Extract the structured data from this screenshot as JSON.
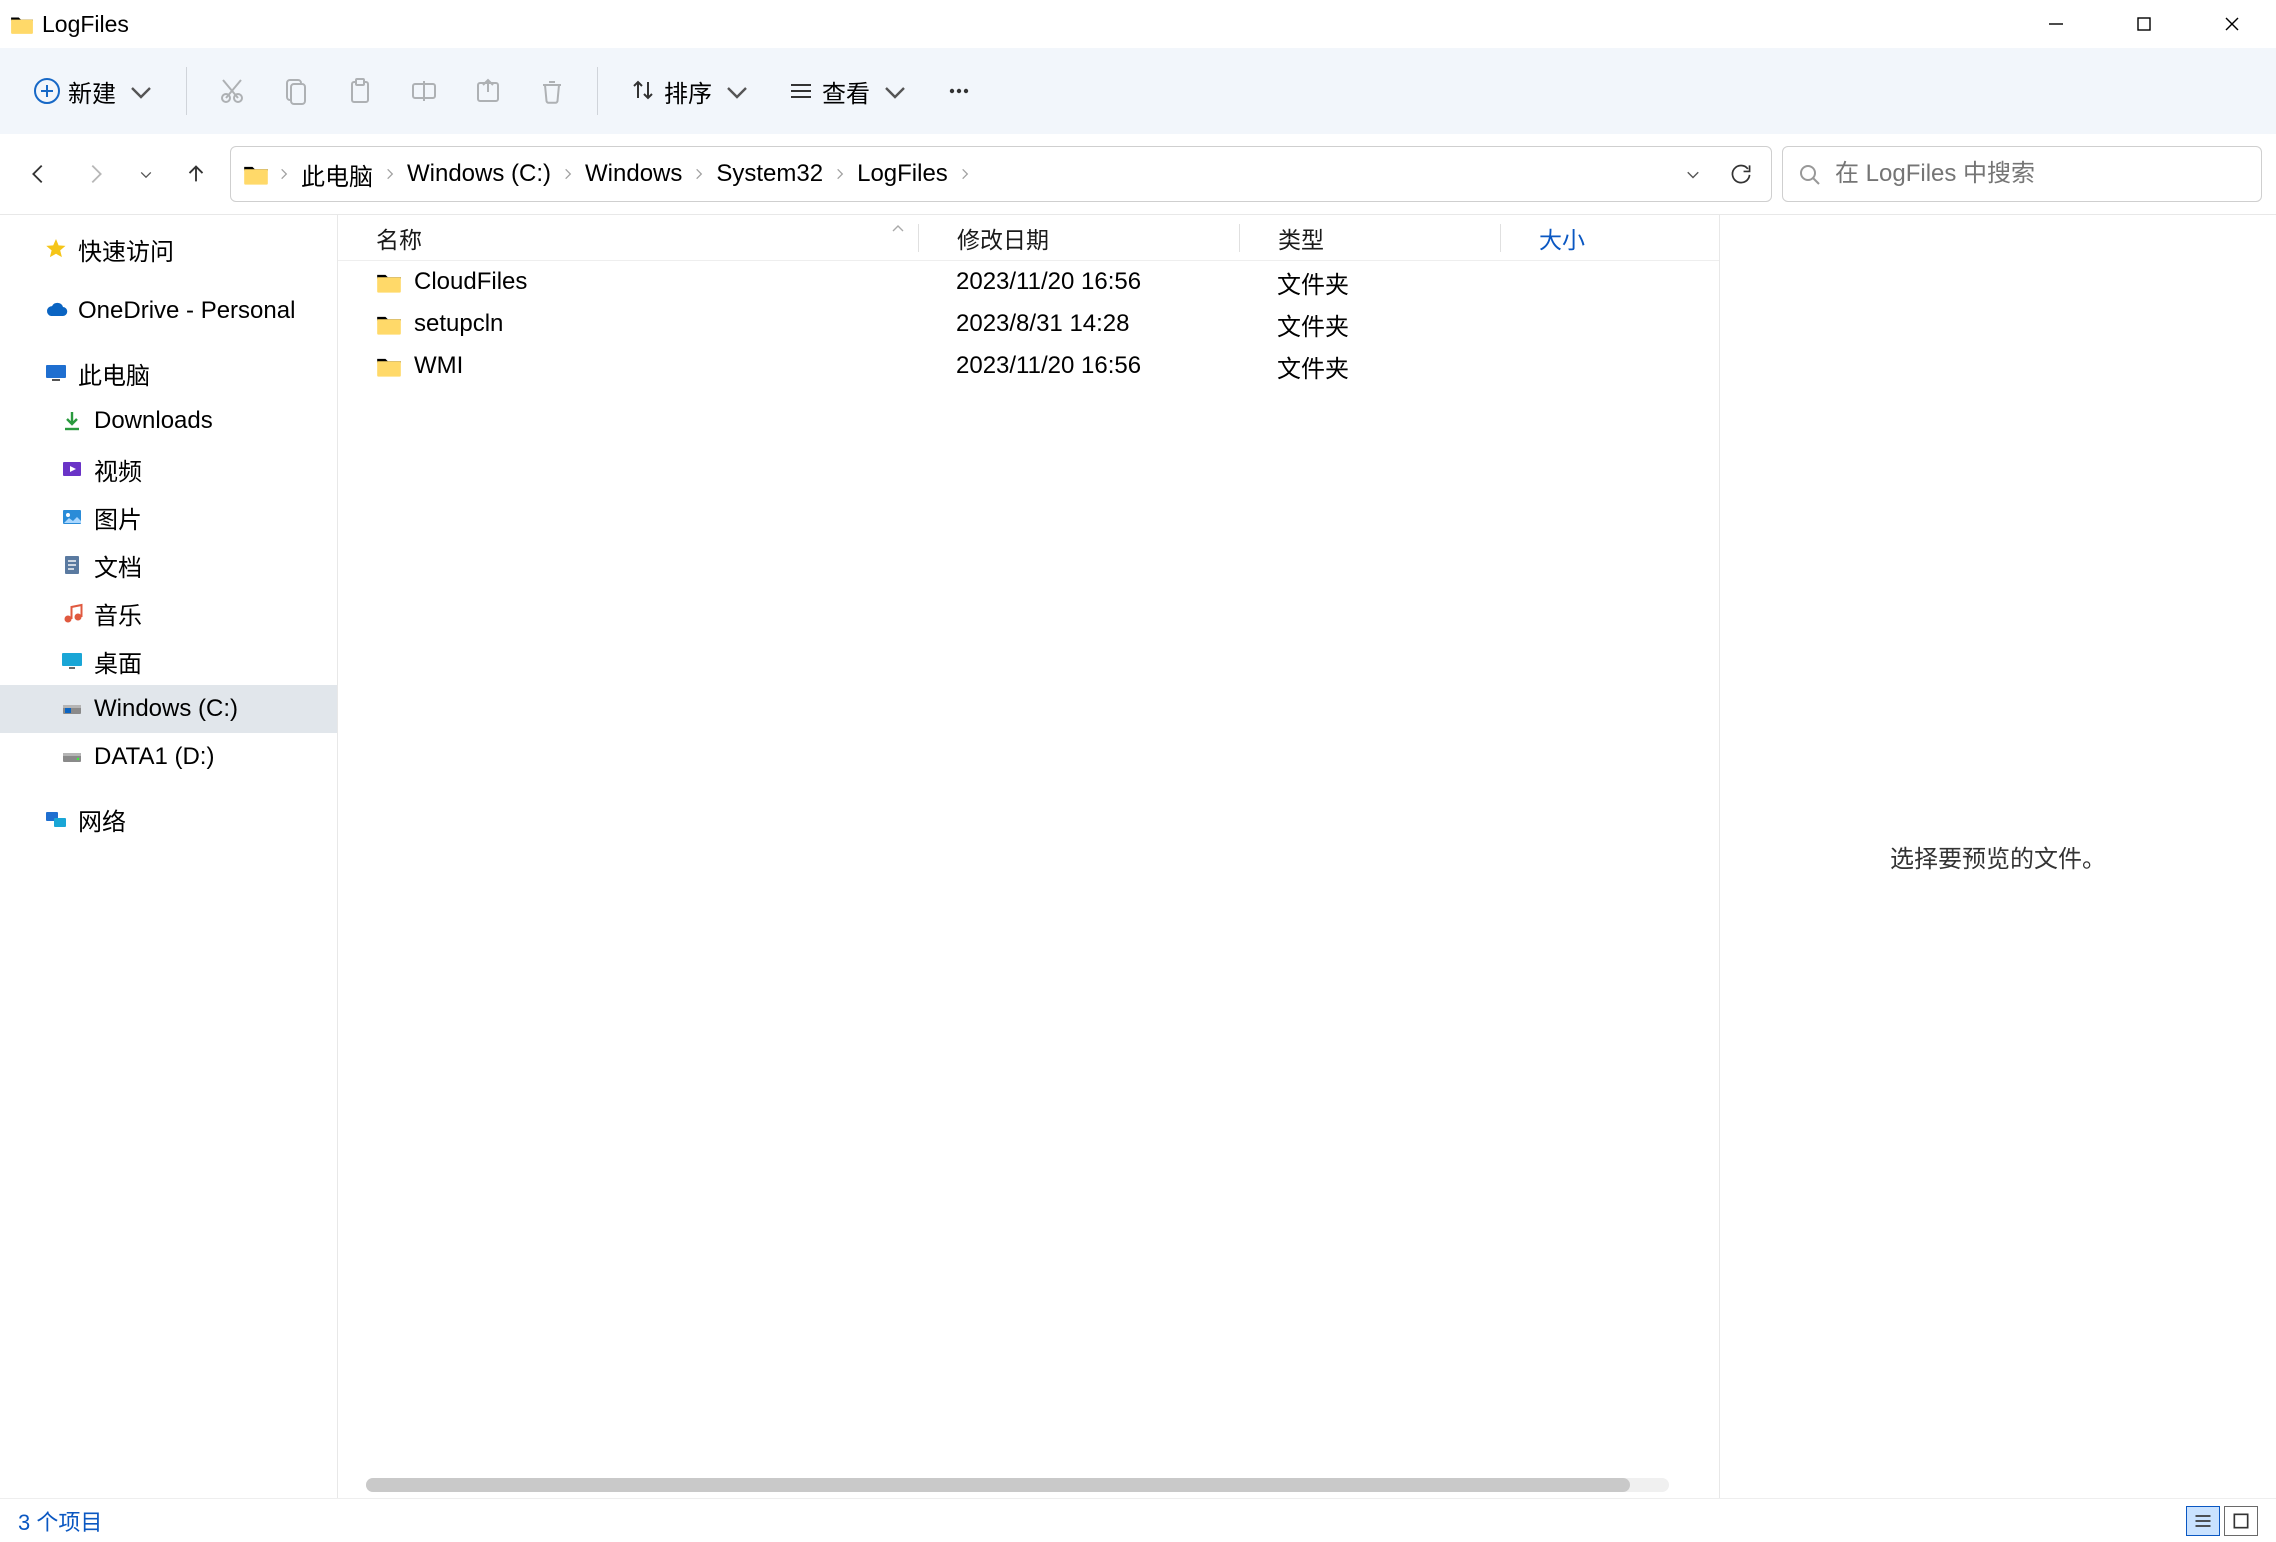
{
  "window": {
    "title": "LogFiles"
  },
  "toolbar": {
    "new_label": "新建",
    "sort_label": "排序",
    "view_label": "查看"
  },
  "breadcrumb": {
    "items": [
      "此电脑",
      "Windows (C:)",
      "Windows",
      "System32",
      "LogFiles"
    ]
  },
  "search": {
    "placeholder": "在 LogFiles 中搜索"
  },
  "sidebar": {
    "quick_access": "快速访问",
    "onedrive": "OneDrive - Personal",
    "this_pc": "此电脑",
    "downloads": "Downloads",
    "videos": "视频",
    "pictures": "图片",
    "documents": "文档",
    "music": "音乐",
    "desktop": "桌面",
    "drive_c": "Windows (C:)",
    "drive_d": "DATA1 (D:)",
    "network": "网络"
  },
  "columns": {
    "name": "名称",
    "date": "修改日期",
    "type": "类型",
    "size": "大小"
  },
  "files": [
    {
      "name": "CloudFiles",
      "date": "2023/11/20 16:56",
      "type": "文件夹",
      "size": ""
    },
    {
      "name": "setupcln",
      "date": "2023/8/31 14:28",
      "type": "文件夹",
      "size": ""
    },
    {
      "name": "WMI",
      "date": "2023/11/20 16:56",
      "type": "文件夹",
      "size": ""
    }
  ],
  "preview": {
    "empty_text": "选择要预览的文件。"
  },
  "status": {
    "text": "3 个项目"
  }
}
